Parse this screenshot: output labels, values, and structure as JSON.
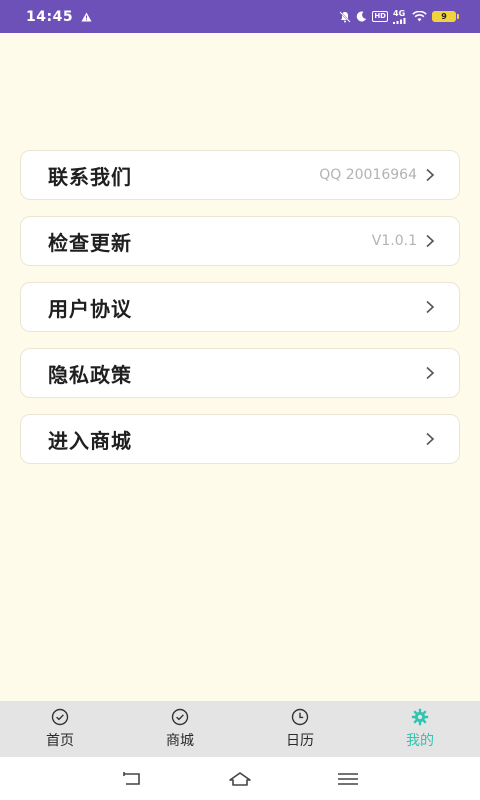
{
  "status_bar": {
    "time": "14:45",
    "hd": "HD",
    "network": "4G",
    "battery": "9"
  },
  "menu": [
    {
      "label": "联系我们",
      "value": "QQ 20016964"
    },
    {
      "label": "检查更新",
      "value": "V1.0.1"
    },
    {
      "label": "用户协议",
      "value": ""
    },
    {
      "label": "隐私政策",
      "value": ""
    },
    {
      "label": "进入商城",
      "value": ""
    }
  ],
  "tabs": [
    {
      "label": "首页",
      "icon": "check-circle-icon"
    },
    {
      "label": "商城",
      "icon": "check-circle-icon"
    },
    {
      "label": "日历",
      "icon": "clock-icon"
    },
    {
      "label": "我的",
      "icon": "gear-icon",
      "active": true
    }
  ],
  "colors": {
    "status_bar": "#6e51b8",
    "background": "#fffbea",
    "active_tab": "#2ec4b0"
  }
}
